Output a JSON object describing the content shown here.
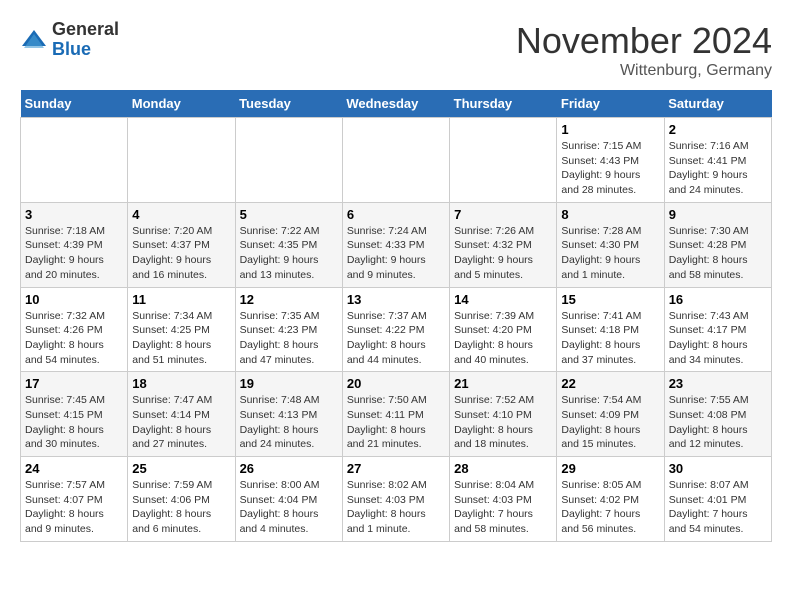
{
  "logo": {
    "general": "General",
    "blue": "Blue"
  },
  "title": "November 2024",
  "location": "Wittenburg, Germany",
  "days_of_week": [
    "Sunday",
    "Monday",
    "Tuesday",
    "Wednesday",
    "Thursday",
    "Friday",
    "Saturday"
  ],
  "weeks": [
    [
      {
        "day": "",
        "info": ""
      },
      {
        "day": "",
        "info": ""
      },
      {
        "day": "",
        "info": ""
      },
      {
        "day": "",
        "info": ""
      },
      {
        "day": "",
        "info": ""
      },
      {
        "day": "1",
        "info": "Sunrise: 7:15 AM\nSunset: 4:43 PM\nDaylight: 9 hours and 28 minutes."
      },
      {
        "day": "2",
        "info": "Sunrise: 7:16 AM\nSunset: 4:41 PM\nDaylight: 9 hours and 24 minutes."
      }
    ],
    [
      {
        "day": "3",
        "info": "Sunrise: 7:18 AM\nSunset: 4:39 PM\nDaylight: 9 hours and 20 minutes."
      },
      {
        "day": "4",
        "info": "Sunrise: 7:20 AM\nSunset: 4:37 PM\nDaylight: 9 hours and 16 minutes."
      },
      {
        "day": "5",
        "info": "Sunrise: 7:22 AM\nSunset: 4:35 PM\nDaylight: 9 hours and 13 minutes."
      },
      {
        "day": "6",
        "info": "Sunrise: 7:24 AM\nSunset: 4:33 PM\nDaylight: 9 hours and 9 minutes."
      },
      {
        "day": "7",
        "info": "Sunrise: 7:26 AM\nSunset: 4:32 PM\nDaylight: 9 hours and 5 minutes."
      },
      {
        "day": "8",
        "info": "Sunrise: 7:28 AM\nSunset: 4:30 PM\nDaylight: 9 hours and 1 minute."
      },
      {
        "day": "9",
        "info": "Sunrise: 7:30 AM\nSunset: 4:28 PM\nDaylight: 8 hours and 58 minutes."
      }
    ],
    [
      {
        "day": "10",
        "info": "Sunrise: 7:32 AM\nSunset: 4:26 PM\nDaylight: 8 hours and 54 minutes."
      },
      {
        "day": "11",
        "info": "Sunrise: 7:34 AM\nSunset: 4:25 PM\nDaylight: 8 hours and 51 minutes."
      },
      {
        "day": "12",
        "info": "Sunrise: 7:35 AM\nSunset: 4:23 PM\nDaylight: 8 hours and 47 minutes."
      },
      {
        "day": "13",
        "info": "Sunrise: 7:37 AM\nSunset: 4:22 PM\nDaylight: 8 hours and 44 minutes."
      },
      {
        "day": "14",
        "info": "Sunrise: 7:39 AM\nSunset: 4:20 PM\nDaylight: 8 hours and 40 minutes."
      },
      {
        "day": "15",
        "info": "Sunrise: 7:41 AM\nSunset: 4:18 PM\nDaylight: 8 hours and 37 minutes."
      },
      {
        "day": "16",
        "info": "Sunrise: 7:43 AM\nSunset: 4:17 PM\nDaylight: 8 hours and 34 minutes."
      }
    ],
    [
      {
        "day": "17",
        "info": "Sunrise: 7:45 AM\nSunset: 4:15 PM\nDaylight: 8 hours and 30 minutes."
      },
      {
        "day": "18",
        "info": "Sunrise: 7:47 AM\nSunset: 4:14 PM\nDaylight: 8 hours and 27 minutes."
      },
      {
        "day": "19",
        "info": "Sunrise: 7:48 AM\nSunset: 4:13 PM\nDaylight: 8 hours and 24 minutes."
      },
      {
        "day": "20",
        "info": "Sunrise: 7:50 AM\nSunset: 4:11 PM\nDaylight: 8 hours and 21 minutes."
      },
      {
        "day": "21",
        "info": "Sunrise: 7:52 AM\nSunset: 4:10 PM\nDaylight: 8 hours and 18 minutes."
      },
      {
        "day": "22",
        "info": "Sunrise: 7:54 AM\nSunset: 4:09 PM\nDaylight: 8 hours and 15 minutes."
      },
      {
        "day": "23",
        "info": "Sunrise: 7:55 AM\nSunset: 4:08 PM\nDaylight: 8 hours and 12 minutes."
      }
    ],
    [
      {
        "day": "24",
        "info": "Sunrise: 7:57 AM\nSunset: 4:07 PM\nDaylight: 8 hours and 9 minutes."
      },
      {
        "day": "25",
        "info": "Sunrise: 7:59 AM\nSunset: 4:06 PM\nDaylight: 8 hours and 6 minutes."
      },
      {
        "day": "26",
        "info": "Sunrise: 8:00 AM\nSunset: 4:04 PM\nDaylight: 8 hours and 4 minutes."
      },
      {
        "day": "27",
        "info": "Sunrise: 8:02 AM\nSunset: 4:03 PM\nDaylight: 8 hours and 1 minute."
      },
      {
        "day": "28",
        "info": "Sunrise: 8:04 AM\nSunset: 4:03 PM\nDaylight: 7 hours and 58 minutes."
      },
      {
        "day": "29",
        "info": "Sunrise: 8:05 AM\nSunset: 4:02 PM\nDaylight: 7 hours and 56 minutes."
      },
      {
        "day": "30",
        "info": "Sunrise: 8:07 AM\nSunset: 4:01 PM\nDaylight: 7 hours and 54 minutes."
      }
    ]
  ]
}
